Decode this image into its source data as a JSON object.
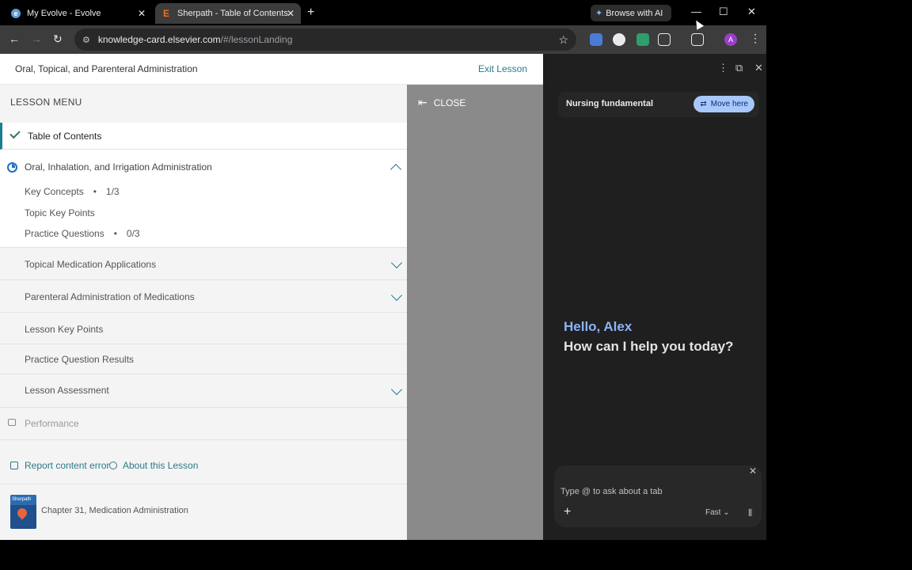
{
  "tabs": [
    {
      "title": "My Evolve - Evolve",
      "favicon": "evolve-favicon"
    },
    {
      "title": "Sherpath - Table of Contents",
      "favicon": "E"
    }
  ],
  "browse_ai_label": "Browse with AI",
  "address": {
    "host": "knowledge-card.elsevier.com",
    "path": "/#/lessonLanding"
  },
  "avatar_letter": "A",
  "page_header": {
    "title": "Oral, Topical, and Parenteral Administration",
    "exit": "Exit Lesson"
  },
  "menu": {
    "title": "LESSON MENU",
    "toc": "Table of Contents",
    "oral": {
      "label": "Oral, Inhalation, and Irrigation Administration",
      "key_concepts": "Key Concepts",
      "key_concepts_progress": "1/3",
      "topic_key_points": "Topic Key Points",
      "practice_questions": "Practice Questions",
      "practice_questions_progress": "0/3"
    },
    "topical": "Topical Medication Applications",
    "parenteral": "Parenteral Administration of Medications",
    "lesson_key_points": "Lesson Key Points",
    "practice_results": "Practice Question Results",
    "lesson_assessment": "Lesson Assessment",
    "performance": "Performance",
    "report_error": "Report content error",
    "about": "About this Lesson",
    "book_label": "Sherpath",
    "chapter": "Chapter 31, Medication Administration"
  },
  "overlay_close": "CLOSE",
  "side_panel": {
    "chip_label": "Nursing fundamental",
    "move_here": "Move here",
    "hello": "Hello, Alex",
    "help": "How can I help you today?",
    "input_placeholder": "Type @ to ask about a tab",
    "model": "Fast"
  }
}
